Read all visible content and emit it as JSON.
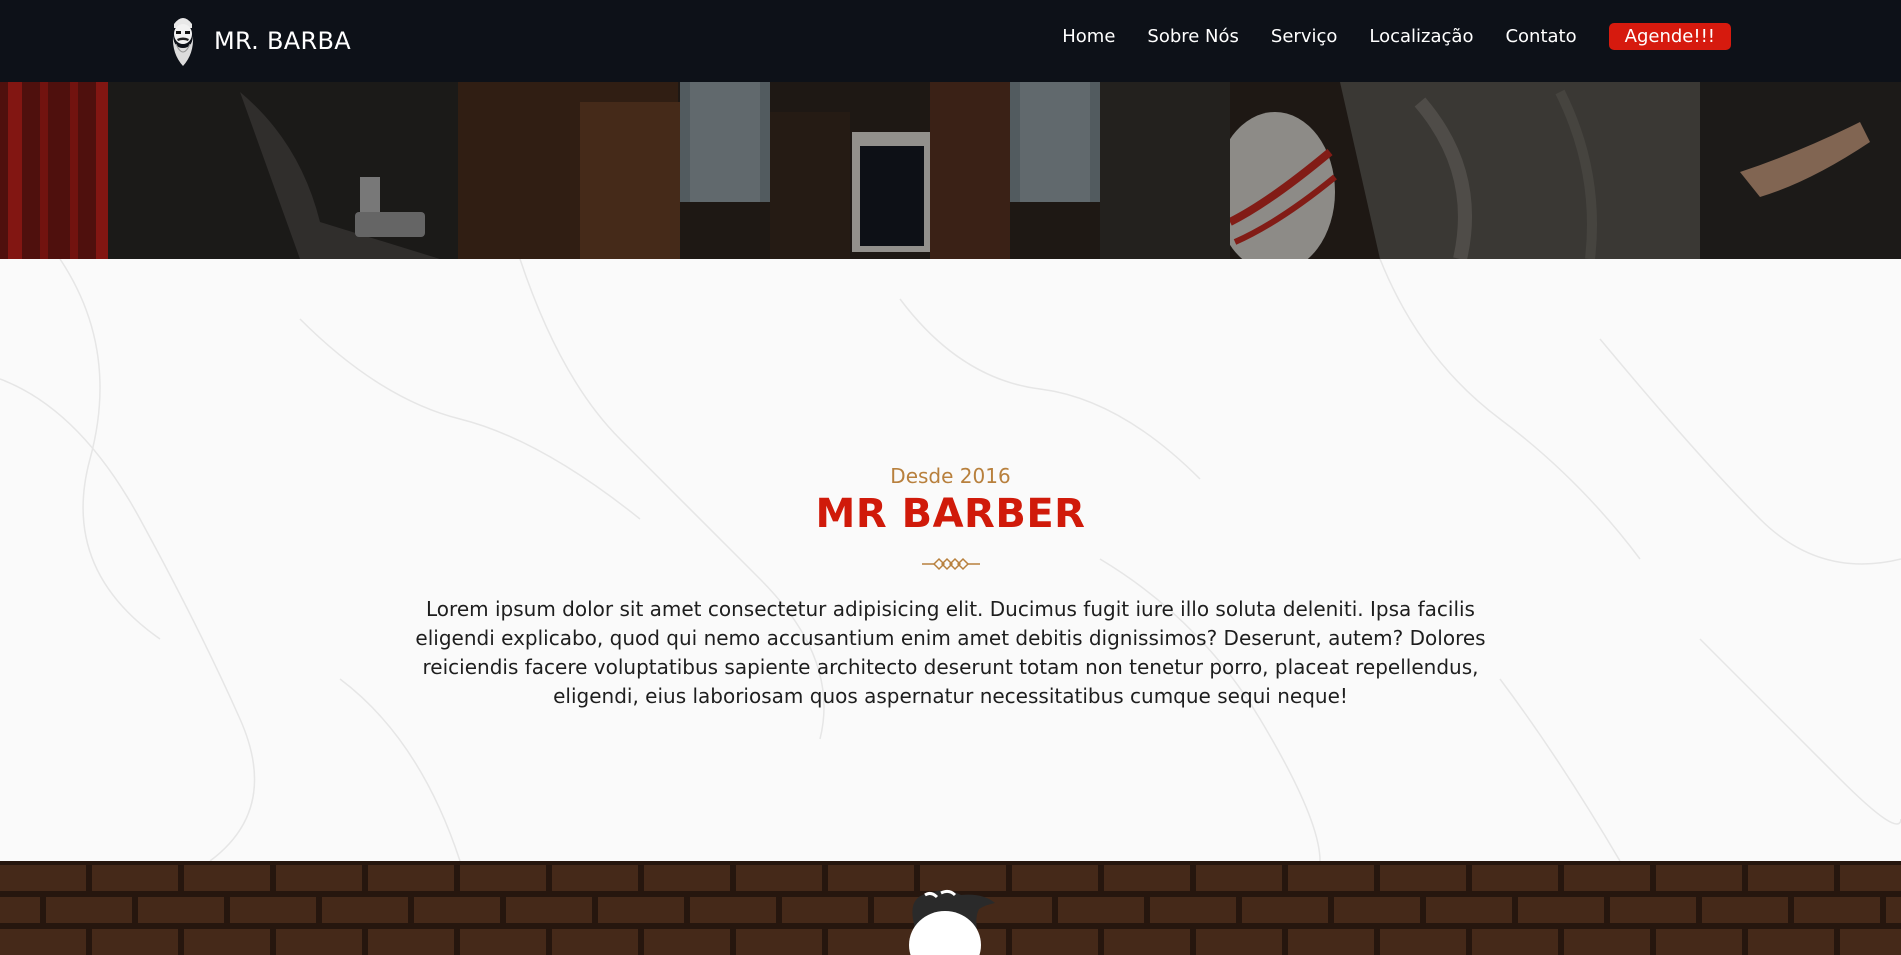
{
  "navbar": {
    "brand_name": "MR. BARBA",
    "logo_icon": "bearded-man-logo",
    "links": [
      "Home",
      "Sobre Nós",
      "Serviço",
      "Localização",
      "Contato"
    ],
    "cta_label": "Agende!!!"
  },
  "about": {
    "eyebrow": "Desde 2016",
    "title": "MR BARBER",
    "divider_icon": "diamond-divider-icon",
    "text": "Lorem ipsum dolor sit amet consectetur adipisicing elit. Ducimus fugit iure illo soluta deleniti. Ipsa facilis eligendi explicabo, quod qui nemo accusantium enim amet debitis dignissimos? Deserunt, autem? Dolores reiciendis facere voluptatibus sapiente architecto deserunt totam non tenetur porro, placeat repellendus, eligendi, eius laboriosam quos aspernatur necessitatibus cumque sequi neque!"
  },
  "colors": {
    "navbar_bg": "#0d1118",
    "cta_red": "#d61a0e",
    "title_red": "#d01a0a",
    "eyebrow_gold": "#b8803d"
  }
}
